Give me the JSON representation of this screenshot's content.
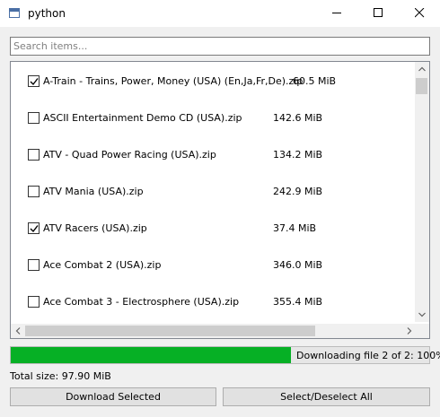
{
  "window": {
    "title": "python"
  },
  "search": {
    "placeholder": "Search items..."
  },
  "items": [
    {
      "name": "A-Train - Trains, Power, Money (USA) (En,Ja,Fr,De).zip",
      "size": "60.5 MiB",
      "checked": true
    },
    {
      "name": "ASCII Entertainment Demo CD (USA).zip",
      "size": "142.6 MiB",
      "checked": false
    },
    {
      "name": "ATV - Quad Power Racing (USA).zip",
      "size": "134.2 MiB",
      "checked": false
    },
    {
      "name": "ATV Mania (USA).zip",
      "size": "242.9 MiB",
      "checked": false
    },
    {
      "name": "ATV Racers (USA).zip",
      "size": "37.4 MiB",
      "checked": true
    },
    {
      "name": "Ace Combat 2 (USA).zip",
      "size": "346.0 MiB",
      "checked": false
    },
    {
      "name": "Ace Combat 3 - Electrosphere (USA).zip",
      "size": "355.4 MiB",
      "checked": false
    }
  ],
  "progress": {
    "value": 0.67,
    "text": "Downloading file 2 of 2: 100%",
    "color": "#06b025"
  },
  "total": {
    "label": "Total size: 97.90 MiB"
  },
  "buttons": {
    "download": "Download Selected",
    "toggle_all": "Select/Deselect All"
  }
}
